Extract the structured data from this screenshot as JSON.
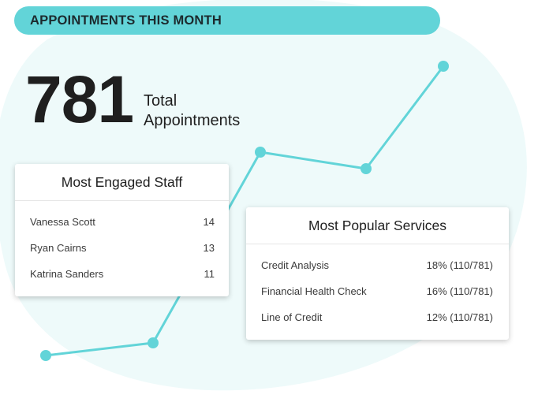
{
  "header": {
    "title": "APPOINTMENTS THIS MONTH"
  },
  "stat": {
    "value": "781",
    "label_line1": "Total",
    "label_line2": "Appointments"
  },
  "colors": {
    "accent": "#62d4d8",
    "background_blob": "#eefafa"
  },
  "trend": {
    "points": 6
  },
  "staff_card": {
    "title": "Most Engaged Staff",
    "rows": [
      {
        "name": "Vanessa Scott",
        "count": "14"
      },
      {
        "name": "Ryan Cairns",
        "count": "13"
      },
      {
        "name": "Katrina Sanders",
        "count": "11"
      }
    ]
  },
  "services_card": {
    "title": "Most Popular Services",
    "rows": [
      {
        "name": "Credit Analysis",
        "share": "18% (110/781)"
      },
      {
        "name": "Financial Health Check",
        "share": "16% (110/781)"
      },
      {
        "name": "Line of Credit",
        "share": "12% (110/781)"
      }
    ]
  }
}
